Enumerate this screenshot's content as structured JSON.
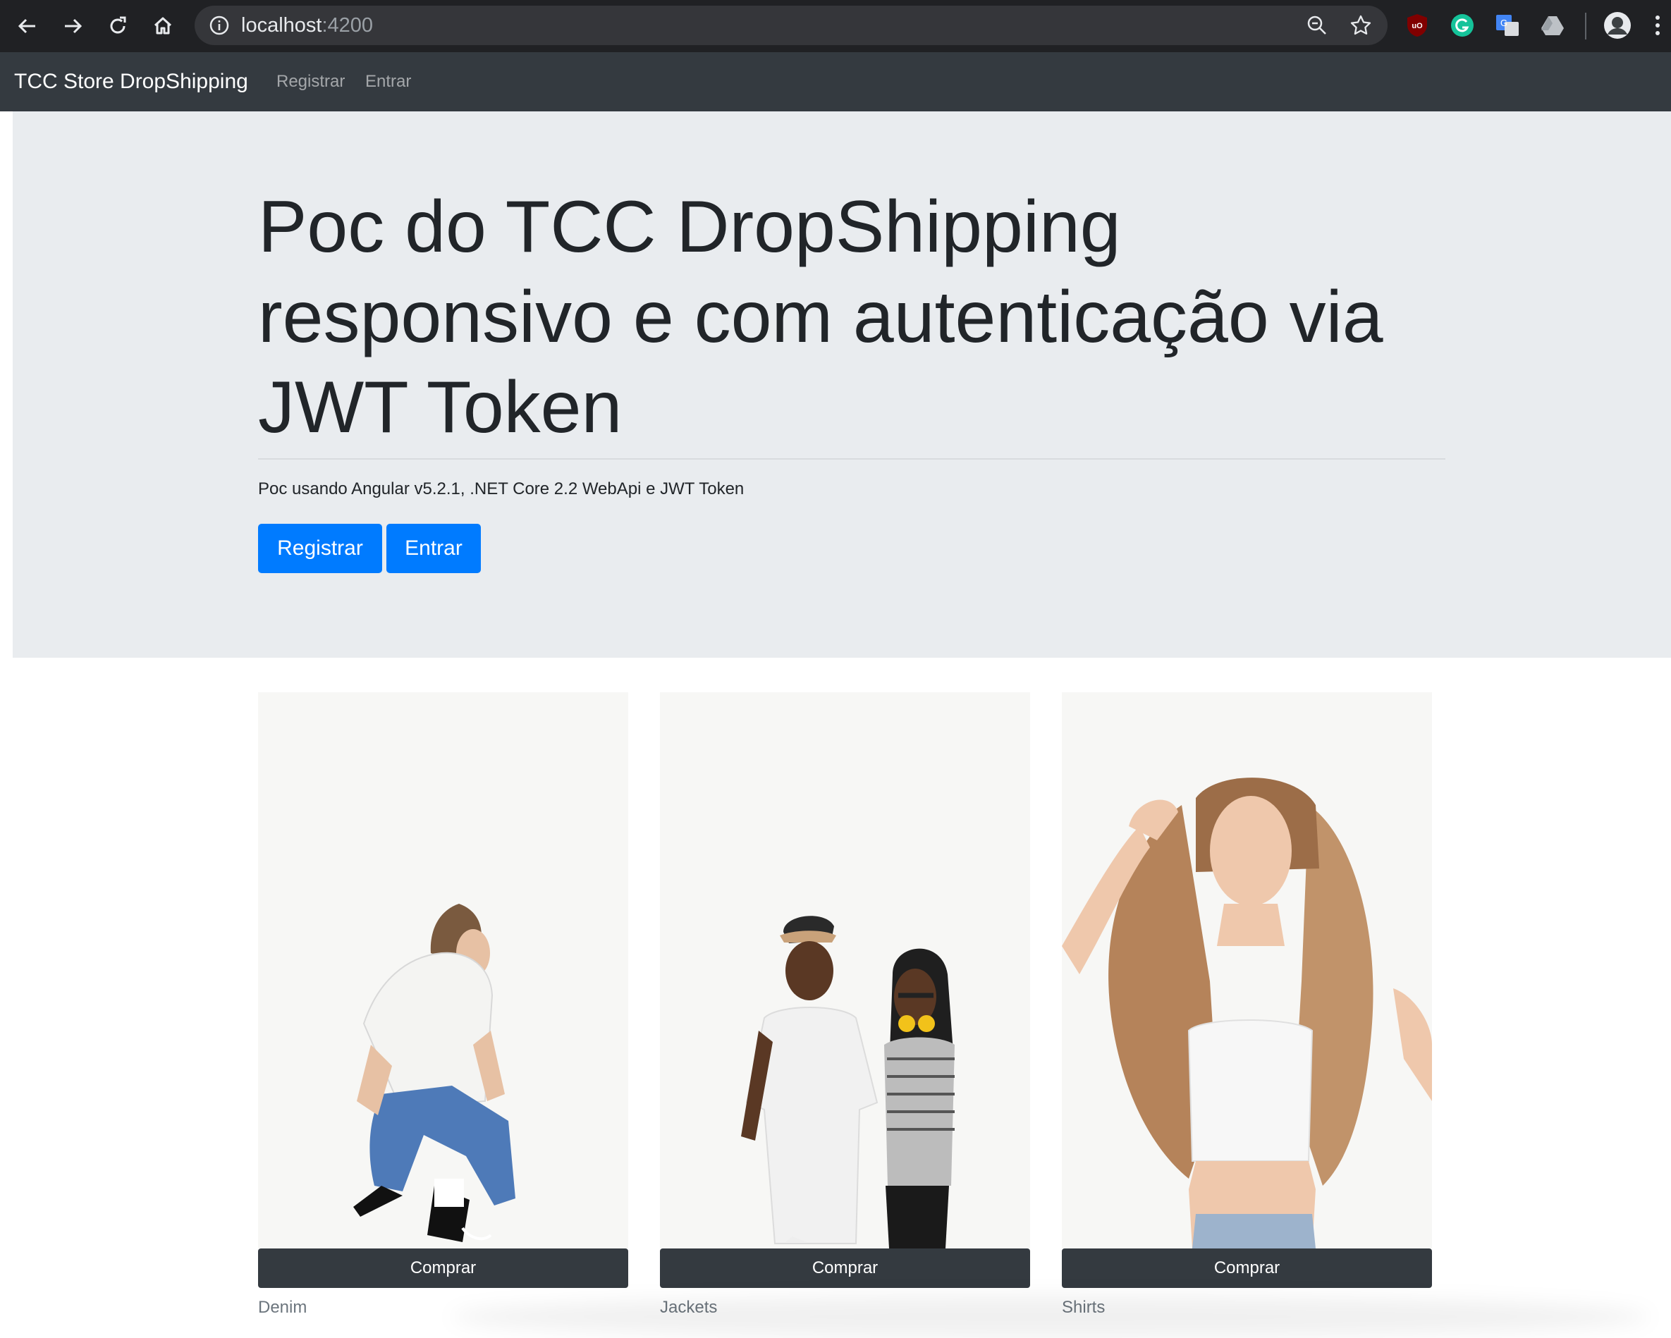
{
  "browser": {
    "url_host": "localhost",
    "url_port": ":4200"
  },
  "navbar": {
    "brand": "TCC Store DropShipping",
    "links": [
      "Registrar",
      "Entrar"
    ]
  },
  "hero": {
    "title": "Poc do TCC DropShipping responsivo e com autenticação via JWT Token",
    "lead": "Poc usando Angular v5.2.1, .NET Core 2.2 WebApi e JWT Token",
    "register_button": "Registrar",
    "login_button": "Entrar"
  },
  "products": [
    {
      "button": "Comprar",
      "category": "Denim"
    },
    {
      "button": "Comprar",
      "category": "Jackets"
    },
    {
      "button": "Comprar",
      "category": "Shirts"
    }
  ],
  "colors": {
    "primary": "#007bff",
    "navbar": "#343a40",
    "jumbotron": "#e9ecef",
    "chrome": "#202124"
  }
}
